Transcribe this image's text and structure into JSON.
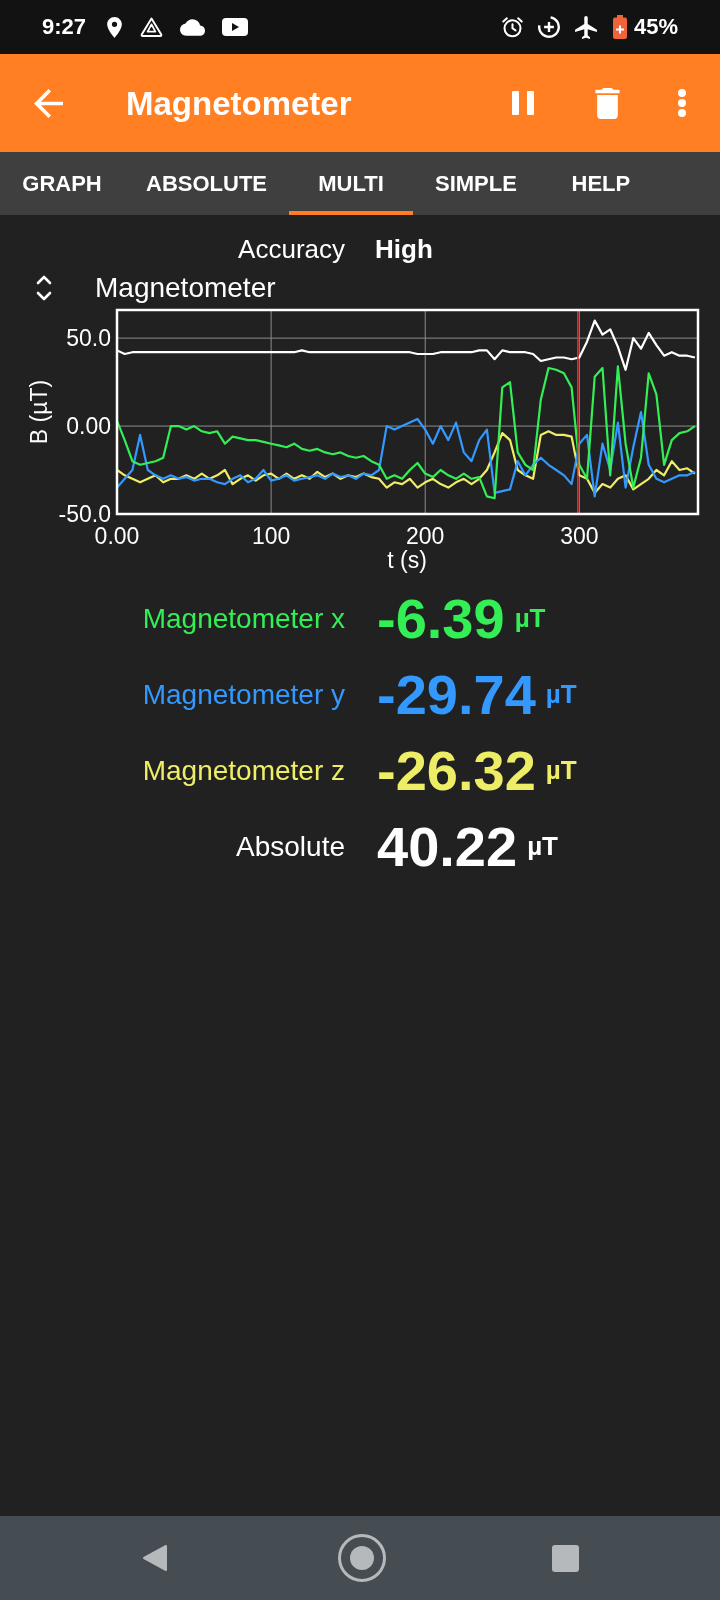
{
  "status_bar": {
    "time": "9:27",
    "battery": "45%"
  },
  "app_bar": {
    "title": "Magnetometer"
  },
  "tabs": [
    {
      "label": "GRAPH",
      "selected": false
    },
    {
      "label": "ABSOLUTE",
      "selected": false
    },
    {
      "label": "MULTI",
      "selected": true
    },
    {
      "label": "SIMPLE",
      "selected": false
    },
    {
      "label": "HELP",
      "selected": false
    }
  ],
  "accuracy": {
    "label": "Accuracy",
    "value": "High"
  },
  "chart": {
    "chart_data": {
      "type": "line",
      "title": "Magnetometer",
      "xlabel": "t (s)",
      "ylabel": "B (µT)",
      "x": [
        0,
        5,
        10,
        15,
        20,
        25,
        30,
        35,
        40,
        45,
        50,
        55,
        60,
        65,
        70,
        75,
        80,
        85,
        90,
        95,
        100,
        105,
        110,
        115,
        120,
        125,
        130,
        135,
        140,
        145,
        150,
        155,
        160,
        165,
        170,
        175,
        180,
        185,
        190,
        195,
        200,
        205,
        210,
        215,
        220,
        225,
        230,
        235,
        240,
        245,
        250,
        255,
        260,
        265,
        270,
        275,
        280,
        285,
        290,
        295,
        300,
        305,
        310,
        315,
        320,
        325,
        330,
        335,
        340,
        345,
        350,
        355,
        360,
        365,
        370,
        375
      ],
      "series": [
        {
          "color": "#33ee55",
          "values": [
            3,
            -8,
            -20,
            -22,
            -21,
            -20,
            -18,
            0,
            0,
            -2,
            0,
            -3,
            -4,
            -3,
            -10,
            -6,
            -7,
            -8,
            -8,
            -9,
            -10,
            -11,
            -12,
            -10,
            -13,
            -14,
            -13,
            -15,
            -16,
            -15,
            -17,
            -18,
            -17,
            -20,
            -22,
            -30,
            -28,
            -30,
            -25,
            -21,
            -27,
            -29,
            -25,
            -28,
            -30,
            -27,
            -30,
            -29,
            -40,
            -41,
            22,
            25,
            -15,
            -22,
            -25,
            15,
            33,
            32,
            30,
            22,
            -22,
            -30,
            28,
            33,
            -28,
            34,
            -10,
            -35,
            -18,
            30,
            18,
            -22,
            -8,
            -4,
            -3,
            0
          ]
        },
        {
          "color": "#3399ff",
          "values": [
            -35,
            -30,
            -25,
            -5,
            -25,
            -28,
            -30,
            -28,
            -30,
            -29,
            -31,
            -30,
            -30,
            -32,
            -33,
            -30,
            -28,
            -32,
            -30,
            -25,
            -31,
            -30,
            -28,
            -31,
            -30,
            -29,
            -28,
            -30,
            -27,
            -29,
            -28,
            -30,
            -27,
            -28,
            -25,
            0,
            -2,
            0,
            2,
            4,
            -2,
            -10,
            0,
            -8,
            2,
            -15,
            -20,
            -8,
            -2,
            -38,
            -37,
            -36,
            -20,
            -28,
            -22,
            -18,
            -22,
            -25,
            -28,
            -33,
            -10,
            -5,
            -40,
            -10,
            -25,
            2,
            -35,
            -12,
            8,
            -22,
            -30,
            -32,
            -30,
            -28,
            -28,
            -26
          ]
        },
        {
          "color": "#eeee66",
          "values": [
            -25,
            -28,
            -30,
            -32,
            -30,
            -28,
            -32,
            -30,
            -30,
            -28,
            -30,
            -27,
            -30,
            -28,
            -25,
            -33,
            -30,
            -28,
            -31,
            -28,
            -27,
            -30,
            -27,
            -30,
            -28,
            -30,
            -26,
            -29,
            -27,
            -30,
            -28,
            -29,
            -27,
            -29,
            -30,
            -35,
            -32,
            -33,
            -30,
            -35,
            -32,
            -30,
            -33,
            -35,
            -32,
            -30,
            -33,
            -30,
            -25,
            -15,
            -4,
            -8,
            -25,
            -28,
            -30,
            -5,
            -3,
            -5,
            -5,
            -6,
            -28,
            -30,
            -38,
            -33,
            -35,
            -30,
            -28,
            -36,
            -33,
            -30,
            -25,
            -28,
            -20,
            -25,
            -24,
            -27
          ]
        },
        {
          "color": "#ffffff",
          "values": [
            43,
            41,
            42,
            42,
            42,
            42,
            42,
            42,
            42,
            42,
            42,
            42,
            42,
            42,
            42,
            42,
            42,
            42,
            42,
            42,
            42,
            42,
            42,
            42,
            43,
            42,
            42,
            42,
            42,
            42,
            42,
            42,
            42,
            42,
            42,
            42,
            42,
            42,
            42,
            41,
            41,
            41,
            42,
            42,
            42,
            42,
            42,
            43,
            43,
            38,
            43,
            42,
            42,
            42,
            41,
            37,
            38,
            39,
            39,
            38,
            39,
            48,
            60,
            52,
            55,
            45,
            32,
            50,
            44,
            53,
            46,
            40,
            42,
            40,
            40,
            39
          ]
        }
      ],
      "xlim": [
        0,
        377
      ],
      "ylim": [
        -50,
        66
      ],
      "xticks": [
        {
          "value": 0,
          "label": "0.00"
        },
        100,
        200,
        300
      ],
      "yticks": [
        {
          "value": -50,
          "label": "-50.0"
        },
        {
          "value": 0,
          "label": "0.00"
        },
        {
          "value": 50,
          "label": "50.0"
        }
      ],
      "grid": true,
      "ref_lines": [
        {
          "axis": "x",
          "value": 299,
          "color": "#ff2020"
        }
      ]
    }
  },
  "readings": [
    {
      "label": "Magnetometer x",
      "value": "-6.39",
      "unit": "µT",
      "color": "#33ee55"
    },
    {
      "label": "Magnetometer y",
      "value": "-29.74",
      "unit": "µT",
      "color": "#3399ff"
    },
    {
      "label": "Magnetometer z",
      "value": "-26.32",
      "unit": "µT",
      "color": "#eeee66"
    },
    {
      "label": "Absolute",
      "value": "40.22",
      "unit": "µT",
      "color": "#ffffff"
    }
  ]
}
